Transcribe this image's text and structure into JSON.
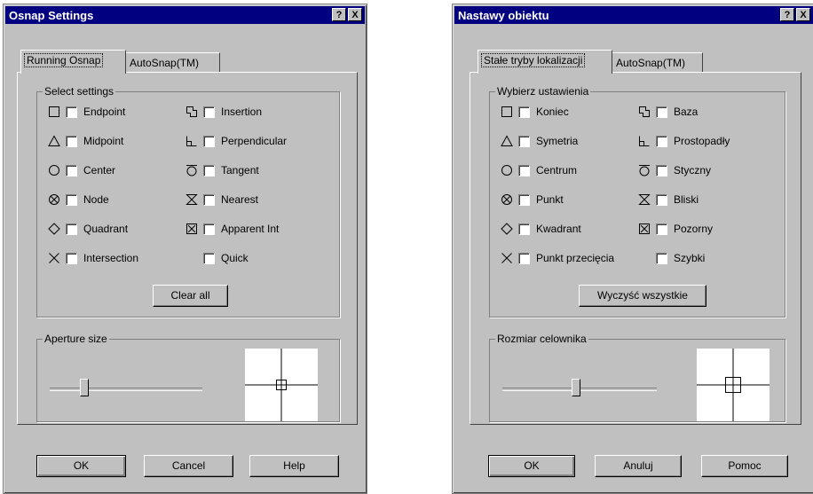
{
  "left": {
    "title": "Osnap Settings",
    "help_btn": "?",
    "close_btn": "X",
    "tabs": [
      "Running Osnap",
      "AutoSnap(TM)"
    ],
    "group_title": "Select settings",
    "items_left": [
      "Endpoint",
      "Midpoint",
      "Center",
      "Node",
      "Quadrant",
      "Intersection"
    ],
    "items_right": [
      "Insertion",
      "Perpendicular",
      "Tangent",
      "Nearest",
      "Apparent Int",
      "Quick"
    ],
    "clear_all": "Clear all",
    "aperture_title": "Aperture size",
    "buttons": [
      "OK",
      "Cancel",
      "Help"
    ]
  },
  "right": {
    "title": "Nastawy obiektu",
    "help_btn": "?",
    "close_btn": "X",
    "tabs": [
      "Stałe tryby lokalizacji",
      "AutoSnap(TM)"
    ],
    "group_title": "Wybierz ustawienia",
    "items_left": [
      "Koniec",
      "Symetria",
      "Centrum",
      "Punkt",
      "Kwadrant",
      "Punkt przecięcia"
    ],
    "items_right": [
      "Baza",
      "Prostopadły",
      "Styczny",
      "Bliski",
      "Pozorny",
      "Szybki"
    ],
    "clear_all": "Wyczyść wszystkie",
    "aperture_title": "Rozmiar celownika",
    "buttons": [
      "OK",
      "Anuluj",
      "Pomoc"
    ]
  },
  "symbols_left": [
    "endpoint-square-icon",
    "midpoint-triangle-icon",
    "center-circle-icon",
    "node-icon",
    "quadrant-diamond-icon",
    "intersection-x-icon"
  ],
  "symbols_right": [
    "insertion-icon",
    "perpendicular-icon",
    "tangent-icon",
    "nearest-icon",
    "apparent-int-icon",
    ""
  ]
}
